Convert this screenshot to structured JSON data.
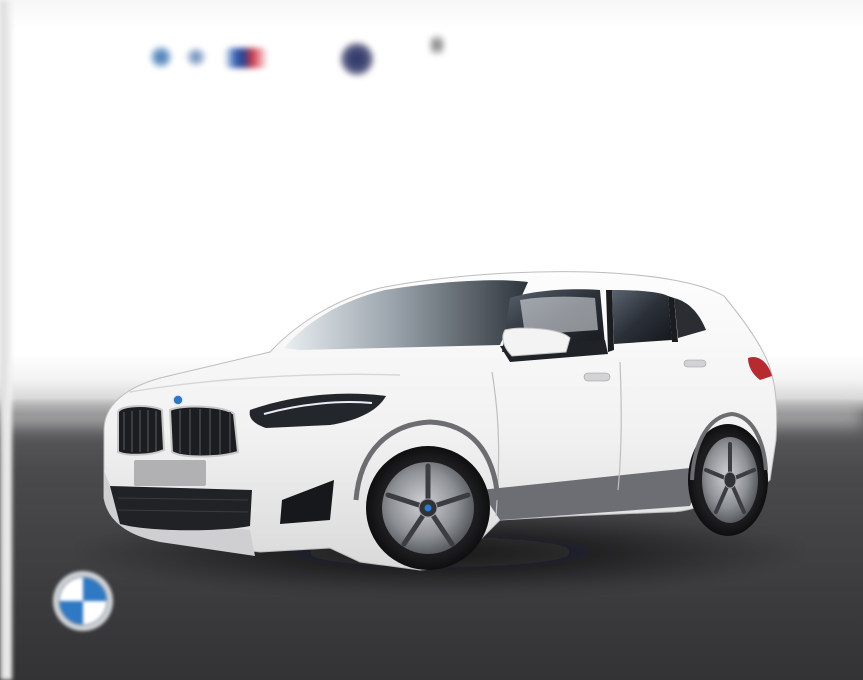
{
  "scene": {
    "subject": "white-suv",
    "brand_logo": "bmw-roundel",
    "colors": {
      "wall": "#ffffff",
      "floor": "#3d3d3f",
      "car_body": "#f6f6f6",
      "roundel_blue": "#2f78c4"
    }
  }
}
